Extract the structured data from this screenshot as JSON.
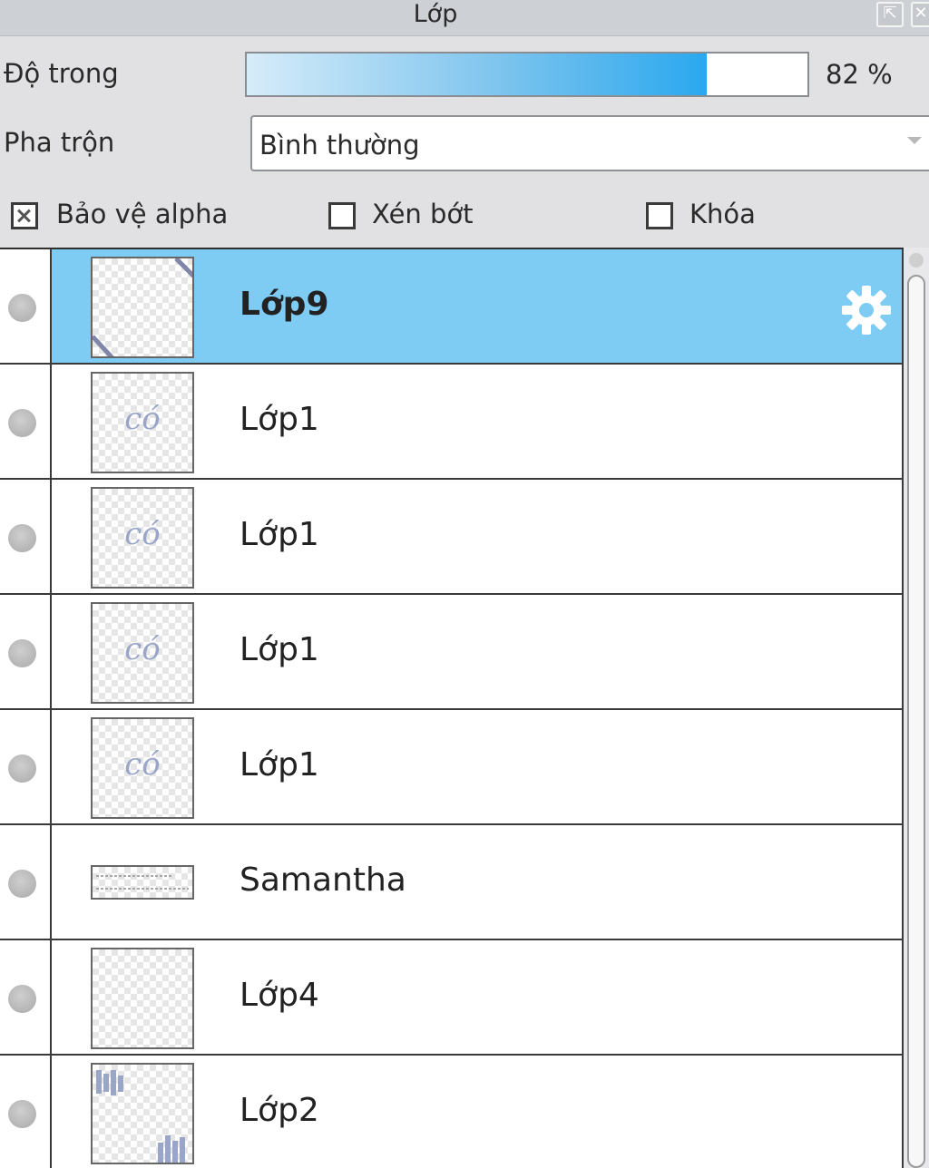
{
  "panel": {
    "title": "Lớp"
  },
  "opacity": {
    "label": "Độ trong",
    "value": 82,
    "display": "82 %"
  },
  "blend": {
    "label": "Pha trộn",
    "selected": "Bình thường"
  },
  "options": [
    {
      "label": "Bảo vệ alpha",
      "checked": true
    },
    {
      "label": "Xén bớt",
      "checked": false
    },
    {
      "label": "Khóa",
      "checked": false
    }
  ],
  "layers": [
    {
      "name": "Lớp9",
      "selected": true,
      "thumb_text": ""
    },
    {
      "name": "Lớp1",
      "selected": false,
      "thumb_text": "có"
    },
    {
      "name": "Lớp1",
      "selected": false,
      "thumb_text": "có"
    },
    {
      "name": "Lớp1",
      "selected": false,
      "thumb_text": "có"
    },
    {
      "name": "Lớp1",
      "selected": false,
      "thumb_text": "có"
    },
    {
      "name": "Samantha",
      "selected": false,
      "thumb_text": ""
    },
    {
      "name": "Lớp4",
      "selected": false,
      "thumb_text": ""
    },
    {
      "name": "Lớp2",
      "selected": false,
      "thumb_text": ""
    }
  ],
  "colors": {
    "selection": "#7ecbf3",
    "accent": "#2aa8ef"
  }
}
